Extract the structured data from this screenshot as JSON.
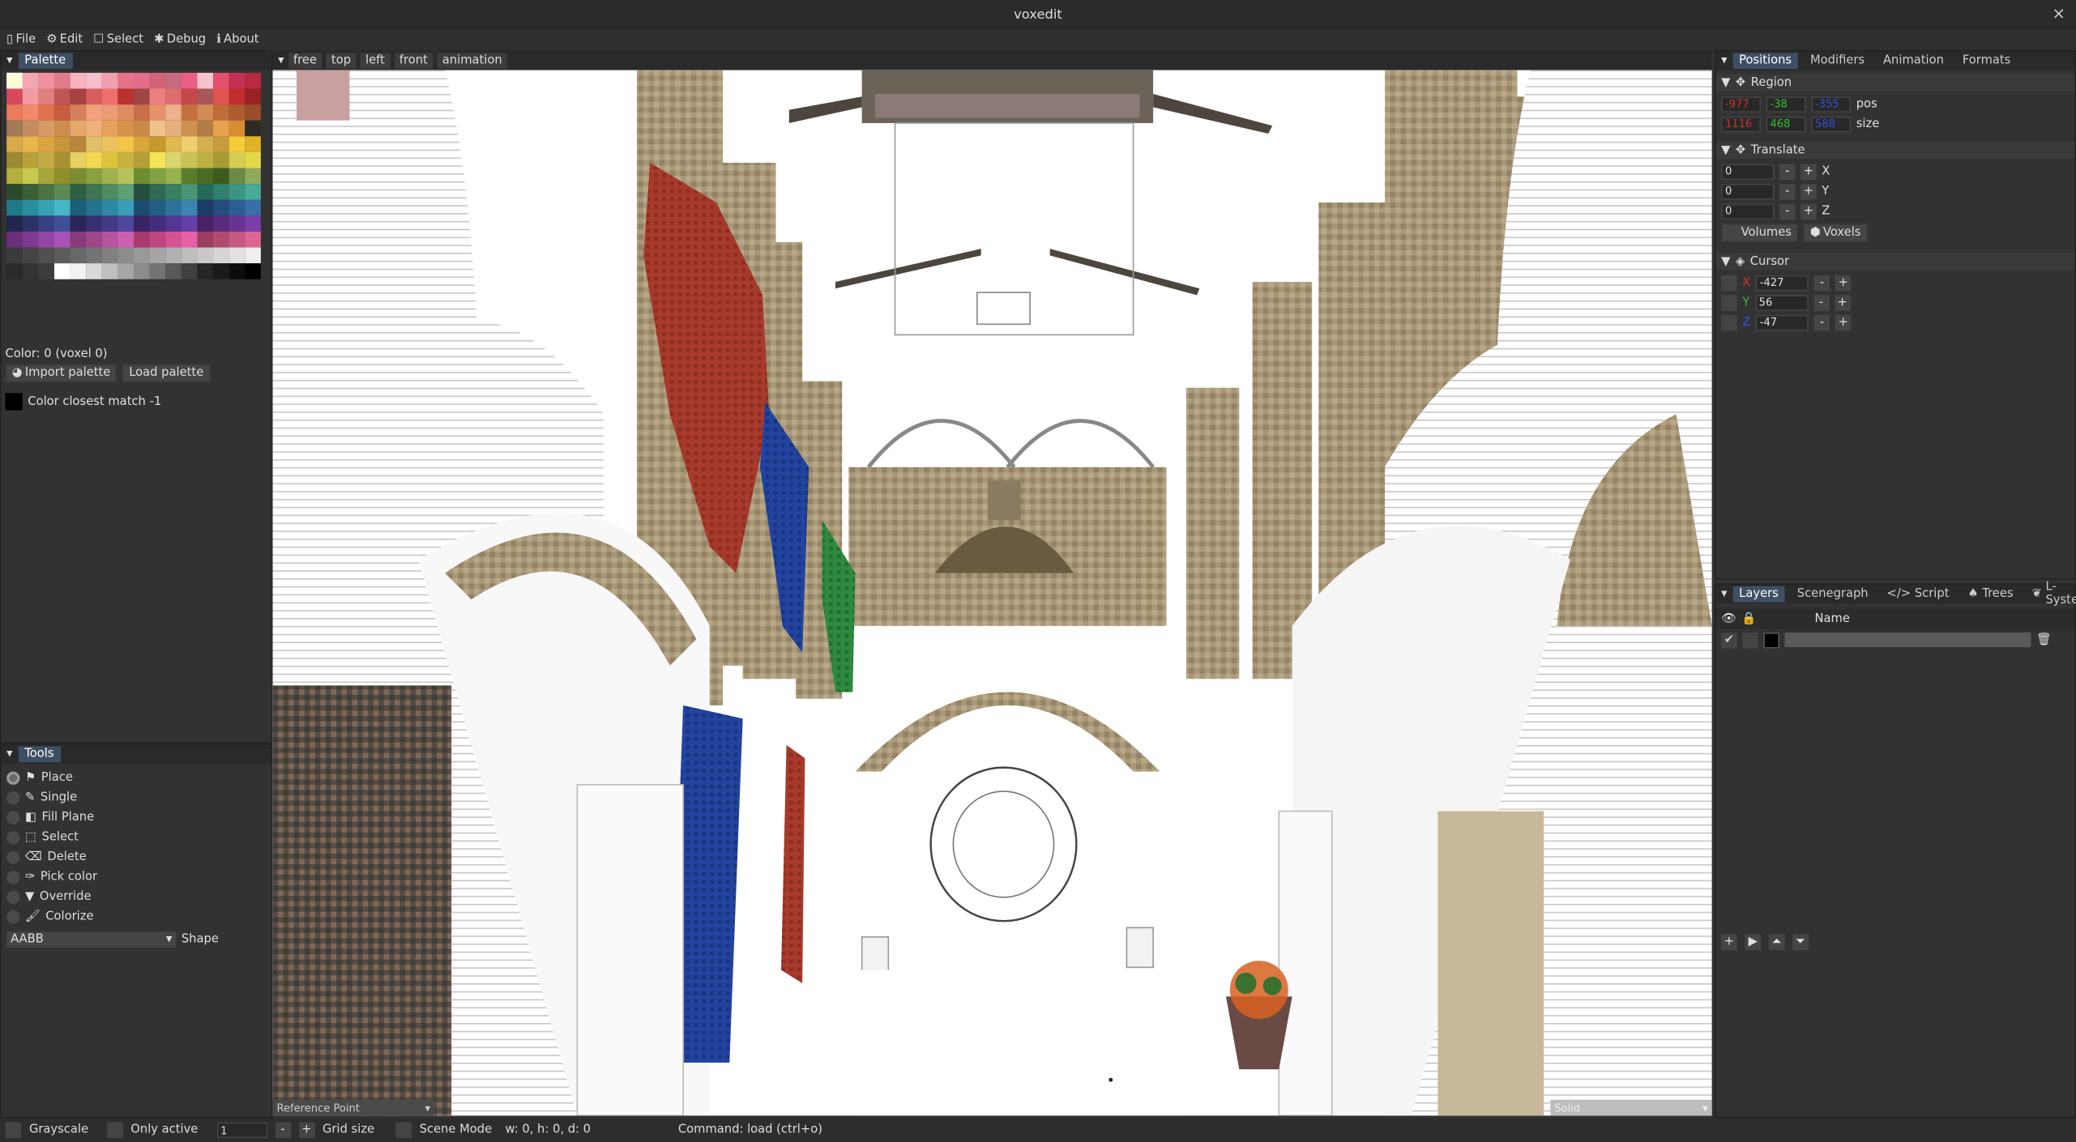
{
  "window": {
    "title": "voxedit",
    "close": "×"
  },
  "menu": [
    {
      "icon": "file-icon",
      "label": "File"
    },
    {
      "icon": "gear-icon",
      "label": "Edit"
    },
    {
      "icon": "select-icon",
      "label": "Select"
    },
    {
      "icon": "bug-icon",
      "label": "Debug"
    },
    {
      "icon": "info-icon",
      "label": "About"
    }
  ],
  "palette": {
    "title": "Palette",
    "color_info": "Color: 0 (voxel 0)",
    "import_label": "Import palette",
    "load_label": "Load palette",
    "closest_match": "Color closest match -1",
    "swatches": [
      "#fefcd0",
      "#f3a7b2",
      "#ef8fa0",
      "#e07c8b",
      "#f8b4be",
      "#f7bfcb",
      "#f2a0b1",
      "#e6728a",
      "#e46d8b",
      "#d36477",
      "#c86b81",
      "#ec5e84",
      "#f8c4cc",
      "#e4516d",
      "#c43154",
      "#b72a3f",
      "#d74a5c",
      "#f39aa2",
      "#e07f7f",
      "#c05656",
      "#a84242",
      "#d85e5e",
      "#ef6e6e",
      "#bb3232",
      "#9f4545",
      "#ec8080",
      "#e06d6d",
      "#c34949",
      "#ab5757",
      "#e15252",
      "#c22c2c",
      "#9b2222",
      "#e97c5d",
      "#f08a6b",
      "#e0714e",
      "#c65d3f",
      "#d7805d",
      "#f3a07f",
      "#eb9b75",
      "#df8c62",
      "#c8704a",
      "#e6926b",
      "#eeb18c",
      "#c3713f",
      "#d28b57",
      "#bf6b3b",
      "#b05c32",
      "#9a4d28",
      "#a47b59",
      "#c48c60",
      "#d89a66",
      "#cc8e4e",
      "#e5a86a",
      "#f0b27a",
      "#e6a15c",
      "#d6914b",
      "#c98948",
      "#f0c28b",
      "#e6b07e",
      "#ce924e",
      "#b17c45",
      "#e8a24d",
      "#d98c33",
      "#2e2b24",
      "#d9aa4c",
      "#e8b64a",
      "#dca442",
      "#c8953d",
      "#b8873c",
      "#e0c06a",
      "#ecc25e",
      "#f2c448",
      "#d8a63a",
      "#c7982c",
      "#e2b850",
      "#f0d06e",
      "#d4b04e",
      "#c79c3e",
      "#f4cc3a",
      "#e2b226",
      "#9c8a33",
      "#b9a03a",
      "#c6aa45",
      "#a99033",
      "#e8d061",
      "#f2d94f",
      "#dcc53d",
      "#c8b140",
      "#b49f38",
      "#f6e457",
      "#dcd46e",
      "#c9c257",
      "#bfb043",
      "#a99b33",
      "#d7cc52",
      "#e3d84a",
      "#b5b03c",
      "#c8c84e",
      "#a6a63a",
      "#8f8f2c",
      "#7c8c33",
      "#8aa043",
      "#a1b351",
      "#b7c25d",
      "#6d8d31",
      "#80a241",
      "#97b24f",
      "#5b7d2b",
      "#4b6b24",
      "#3c5c1f",
      "#6a8a46",
      "#8faa5c",
      "#2c4a2a",
      "#3a6035",
      "#4a7443",
      "#5c8a54",
      "#2f5f42",
      "#3f7552",
      "#4f8b63",
      "#5fa074",
      "#26503e",
      "#2f6a52",
      "#3b7f63",
      "#4a9575",
      "#236a5a",
      "#2f806f",
      "#3a9683",
      "#48ab98",
      "#1f7a8a",
      "#2a8ea0",
      "#37a2b4",
      "#47b6c6",
      "#1b5f7a",
      "#24738f",
      "#2f88a3",
      "#3c9cb7",
      "#1a4d6f",
      "#235f85",
      "#2e729b",
      "#3a86b0",
      "#1c3c66",
      "#244c7d",
      "#2e5d94",
      "#3a6ea9",
      "#22264e",
      "#2c3266",
      "#374081",
      "#434e9b",
      "#2c255a",
      "#372f6f",
      "#433a86",
      "#50469c",
      "#3b2466",
      "#482c7c",
      "#563593",
      "#653fa8",
      "#4b2166",
      "#5a2a7c",
      "#6a3392",
      "#7b3da7",
      "#6a2f7a",
      "#7e3a8f",
      "#9346a4",
      "#a852b8",
      "#8a3a78",
      "#a0468b",
      "#b6539e",
      "#cb60b1",
      "#a83a6e",
      "#be4681",
      "#d35394",
      "#e760a7",
      "#9a3f5f",
      "#b04c70",
      "#c55981",
      "#db6693",
      "#3a3a3a",
      "#454545",
      "#505050",
      "#5c5c5c",
      "#686868",
      "#747474",
      "#808080",
      "#8c8c8c",
      "#999999",
      "#a5a5a5",
      "#b1b1b1",
      "#bdbdbd",
      "#c9c9c9",
      "#d6d6d6",
      "#e2e2e2",
      "#efefef",
      "#2a2a2a",
      "#333333",
      "#3c3c3c",
      "#ffffff",
      "#f2f2f2",
      "#d9d9d9",
      "#bfbfbf",
      "#a6a6a6",
      "#8c8c8c",
      "#737373",
      "#595959",
      "#404040",
      "#262626",
      "#1a1a1a",
      "#0d0d0d",
      "#000000"
    ]
  },
  "tools": {
    "title": "Tools",
    "items": [
      {
        "icon": "place-icon",
        "label": "Place",
        "selected": true
      },
      {
        "icon": "pencil-icon",
        "label": "Single",
        "selected": false
      },
      {
        "icon": "fill-icon",
        "label": "Fill Plane",
        "selected": false
      },
      {
        "icon": "selection-icon",
        "label": "Select",
        "selected": false
      },
      {
        "icon": "eraser-icon",
        "label": "Delete",
        "selected": false
      },
      {
        "icon": "eyedropper-icon",
        "label": "Pick color",
        "selected": false
      },
      {
        "icon": "filter-icon",
        "label": "Override",
        "selected": false
      },
      {
        "icon": "brush-icon",
        "label": "Colorize",
        "selected": false
      }
    ],
    "shape_value": "AABB",
    "shape_label": "Shape"
  },
  "viewport": {
    "modes": [
      "free",
      "top",
      "left",
      "front",
      "animation"
    ],
    "reference_point": "Reference Point",
    "render_mode": "Solid"
  },
  "positions": {
    "tabs": [
      "Positions",
      "Modifiers",
      "Animation",
      "Formats"
    ],
    "region": {
      "title": "Region",
      "pos": [
        "-977",
        "-38",
        "-355"
      ],
      "pos_label": "pos",
      "size": [
        "1116",
        "468",
        "588"
      ],
      "size_label": "size"
    },
    "translate": {
      "title": "Translate",
      "values": [
        "0",
        "0",
        "0"
      ],
      "axes": [
        "X",
        "Y",
        "Z"
      ],
      "volumes_label": "Volumes",
      "voxels_label": "Voxels"
    },
    "cursor": {
      "title": "Cursor",
      "axes": [
        "X",
        "Y",
        "Z"
      ],
      "values": [
        "-427",
        "56",
        "-47"
      ]
    }
  },
  "layers": {
    "tabs": [
      "Layers",
      "Scenegraph",
      "Script",
      "Trees",
      "L-System"
    ],
    "name_header": "Name",
    "layer_name": ""
  },
  "statusbar": {
    "grayscale": "Grayscale",
    "only_active": "Only active",
    "grid_value": "1",
    "grid_label": "Grid size",
    "scene_mode": "Scene Mode",
    "dims": "w: 0, h: 0, d: 0",
    "command": "Command: load (ctrl+o)"
  },
  "colors": {
    "accent": "#3f4f63",
    "x": "#d03030",
    "y": "#30c030",
    "z": "#3050e0"
  }
}
